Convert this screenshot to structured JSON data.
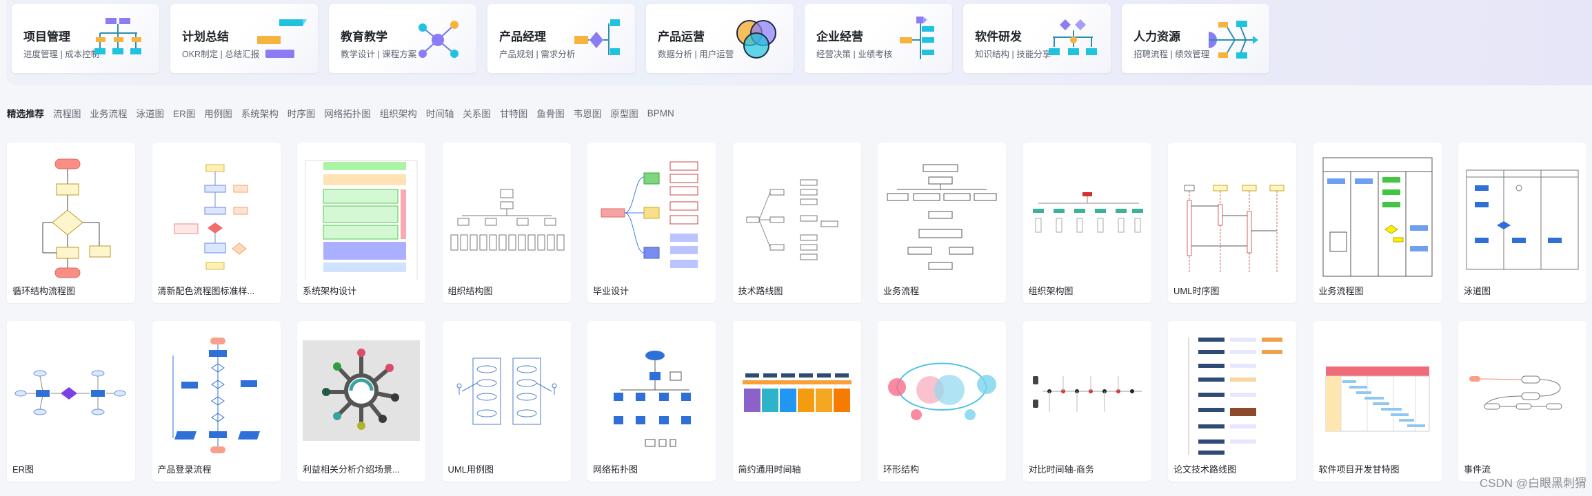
{
  "categories": [
    {
      "title": "项目管理",
      "subtitle": "进度管理 | 成本控制",
      "icon": "org-chart-icon"
    },
    {
      "title": "计划总结",
      "subtitle": "OKR制定 | 总结汇报",
      "icon": "plan-bars-icon"
    },
    {
      "title": "教育教学",
      "subtitle": "教学设计 | 课程方案",
      "icon": "mind-nodes-icon"
    },
    {
      "title": "产品经理",
      "subtitle": "产品规划 | 需求分析",
      "icon": "flow-diamond-icon"
    },
    {
      "title": "产品运营",
      "subtitle": "数据分析 | 用户运营",
      "icon": "venn-icon"
    },
    {
      "title": "企业经营",
      "subtitle": "经营决策 | 业绩考核",
      "icon": "branch-icon"
    },
    {
      "title": "软件研发",
      "subtitle": "知识结构 | 技能分享",
      "icon": "tree-diamond-icon"
    },
    {
      "title": "人力资源",
      "subtitle": "招聘流程 | 绩效管理",
      "icon": "fishbone-icon"
    }
  ],
  "tabs": [
    "精选推荐",
    "流程图",
    "业务流程",
    "泳道图",
    "ER图",
    "用例图",
    "系统架构",
    "时序图",
    "网络拓扑图",
    "组织架构",
    "时间轴",
    "关系图",
    "甘特图",
    "鱼骨图",
    "韦恩图",
    "原型图",
    "BPMN"
  ],
  "templates_row1": [
    {
      "name": "循环结构流程图",
      "thumb": "loop-flowchart"
    },
    {
      "name": "清新配色流程图标准样...",
      "thumb": "color-flowchart"
    },
    {
      "name": "系统架构设计",
      "thumb": "system-architecture"
    },
    {
      "name": "组织结构图",
      "thumb": "org-structure"
    },
    {
      "name": "毕业设计",
      "thumb": "graduation-mindmap"
    },
    {
      "name": "技术路线图",
      "thumb": "tech-roadmap"
    },
    {
      "name": "业务流程",
      "thumb": "business-flow"
    },
    {
      "name": "组织架构图",
      "thumb": "org-chart"
    },
    {
      "name": "UML时序图",
      "thumb": "uml-sequence"
    },
    {
      "name": "业务流程图",
      "thumb": "business-flowchart"
    },
    {
      "name": "泳道图",
      "thumb": "swimlane"
    }
  ],
  "templates_row2": [
    {
      "name": "ER图",
      "thumb": "er-diagram"
    },
    {
      "name": "产品登录流程",
      "thumb": "login-flow"
    },
    {
      "name": "利益相关分析介绍场景...",
      "thumb": "stakeholder-analysis"
    },
    {
      "name": "UML用例图",
      "thumb": "uml-usecase"
    },
    {
      "name": "网络拓扑图",
      "thumb": "network-topology"
    },
    {
      "name": "简约通用时间轴",
      "thumb": "simple-timeline"
    },
    {
      "name": "环形结构",
      "thumb": "ring-structure"
    },
    {
      "name": "对比时间轴-商务",
      "thumb": "compare-timeline"
    },
    {
      "name": "论文技术路线图",
      "thumb": "paper-roadmap"
    },
    {
      "name": "软件项目开发甘特图",
      "thumb": "gantt"
    },
    {
      "name": "事件流",
      "thumb": "event-flow"
    }
  ],
  "watermark": "CSDN @白眼黑刺猬",
  "colors": {
    "accent_purple": "#8b7cf6",
    "accent_cyan": "#1fc3e0",
    "accent_orange": "#f6b33e",
    "text_main": "#1f2329",
    "text_sub": "#646a73"
  }
}
